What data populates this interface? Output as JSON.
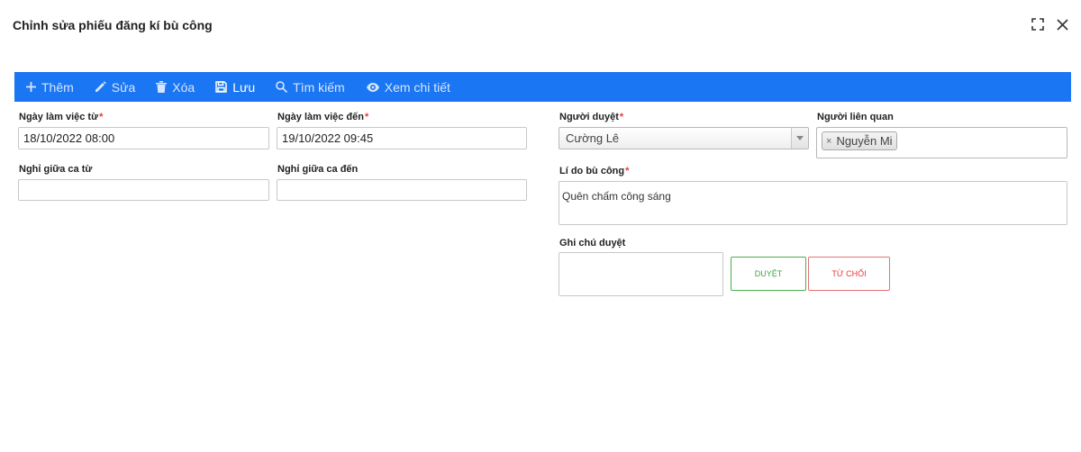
{
  "window": {
    "title": "Chỉnh sửa phiếu đăng kí bù công"
  },
  "toolbar": {
    "add_label": "Thêm",
    "edit_label": "Sửa",
    "delete_label": "Xóa",
    "save_label": "Lưu",
    "search_label": "Tìm kiếm",
    "detail_label": "Xem chi tiết"
  },
  "form": {
    "work_from": {
      "label": "Ngày làm việc từ",
      "required_mark": "*",
      "value": "18/10/2022 08:00"
    },
    "work_to": {
      "label": "Ngày làm việc đến",
      "required_mark": "*",
      "value": "19/10/2022 09:45"
    },
    "break_from": {
      "label": "Nghỉ giữa ca từ",
      "value": ""
    },
    "break_to": {
      "label": "Nghỉ giữa ca đến",
      "value": ""
    },
    "approver": {
      "label": "Người duyệt",
      "required_mark": "*",
      "value": "Cường Lê"
    },
    "related": {
      "label": "Người liên quan",
      "tag_remove": "×",
      "tags": [
        "Nguyễn Mi"
      ]
    },
    "reason": {
      "label": "Lí do bù công",
      "required_mark": "*",
      "value": "Quên chấm công sáng"
    },
    "approval_note": {
      "label": "Ghi chú duyệt",
      "value": ""
    }
  },
  "actions": {
    "approve_label": "DUYỆT",
    "reject_label": "TỪ CHỐI"
  },
  "colors": {
    "toolbar_bg": "#1a76f2",
    "required": "#e53935",
    "approve": "#43a047",
    "reject": "#e53935"
  },
  "icons": {
    "add": "plus-icon",
    "edit": "pencil-icon",
    "delete": "trash-icon",
    "save": "floppy-disk-icon",
    "search": "magnifier-icon",
    "detail": "eye-icon",
    "maximize": "maximize-icon",
    "close": "close-icon"
  }
}
